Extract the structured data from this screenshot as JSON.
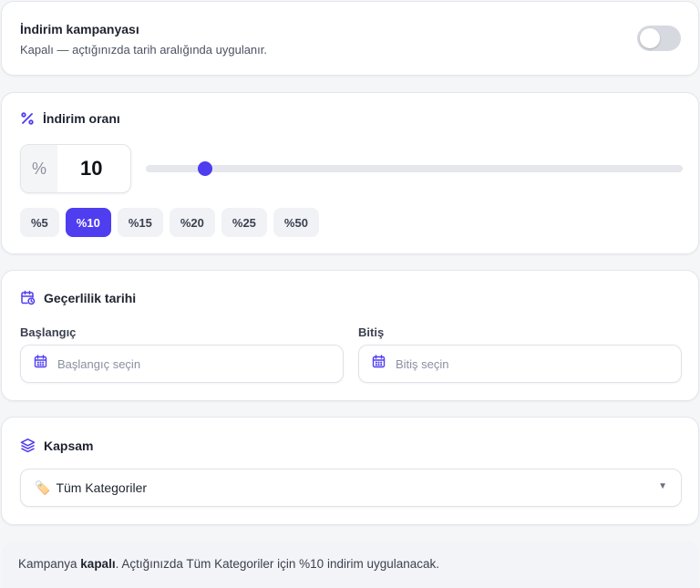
{
  "campaign": {
    "title": "İndirim kampanyası",
    "subtitle": "Kapalı — açtığınızda tarih aralığında uygulanır.",
    "enabled": false
  },
  "rate": {
    "section_title": "İndirim oranı",
    "prefix": "%",
    "value": "10",
    "slider_fraction": 0.11,
    "presets": [
      "%5",
      "%10",
      "%15",
      "%20",
      "%25",
      "%50"
    ],
    "active_preset": "%10"
  },
  "validity": {
    "section_title": "Geçerlilik tarihi",
    "start_label": "Başlangıç",
    "start_placeholder": "Başlangıç seçin",
    "end_label": "Bitiş",
    "end_placeholder": "Bitiş seçin"
  },
  "scope": {
    "section_title": "Kapsam",
    "selected_icon": "🏷️",
    "selected": "Tüm Kategoriler",
    "caret": "▼"
  },
  "summary": {
    "prefix": "Kampanya ",
    "state": "kapalı",
    "rest": ". Açtığınızda Tüm Kategoriler için %10 indirim uygulanacak."
  },
  "colors": {
    "accent": "#4f3df0",
    "toggle_off": "#d6d9df",
    "chip_bg": "#f1f2f5"
  },
  "icons": {
    "rate": "percent-icon",
    "validity": "calendar-clock-icon",
    "date_field": "calendar-icon",
    "scope": "layers-icon",
    "category": "tag-emoji-icon"
  }
}
